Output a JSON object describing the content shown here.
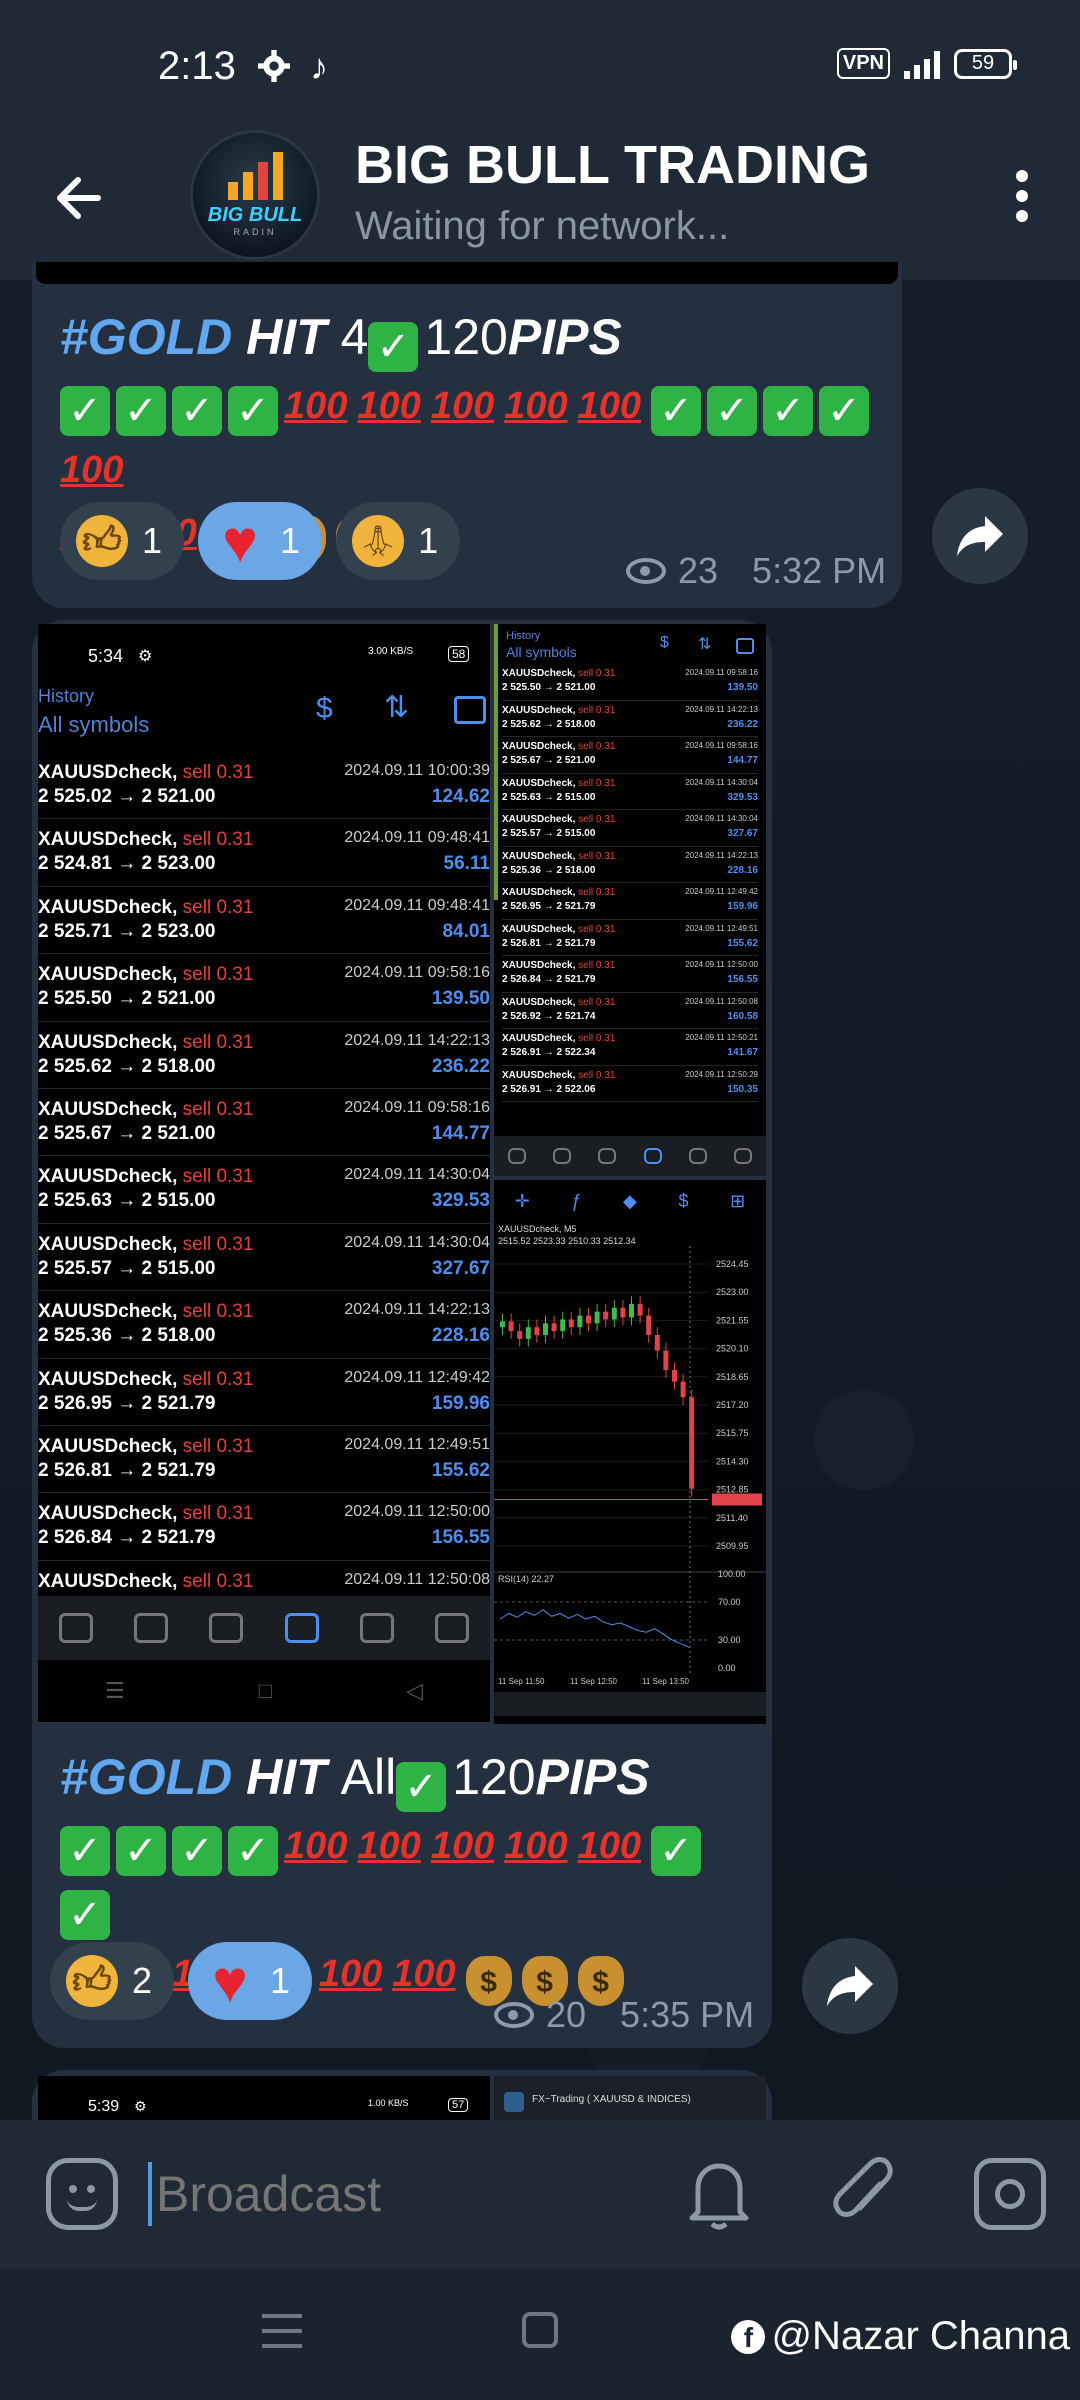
{
  "status": {
    "time": "2:13",
    "vpn": "VPN",
    "battery": "59"
  },
  "header": {
    "title": "BIG BULL TRADING",
    "subtitle": "Waiting for network...",
    "avatar_text": "BIG BULL",
    "avatar_sub": "RADIN"
  },
  "message1": {
    "line1": {
      "hashtag": "#GOLD",
      "hit": "HIT",
      "num": "4",
      "pips_val": "120",
      "pips": "PIPS"
    },
    "reactions": [
      {
        "emoji": "thumbs-up",
        "count": "1"
      },
      {
        "emoji": "heart",
        "count": "1"
      },
      {
        "emoji": "pray",
        "count": "1"
      }
    ],
    "views": "23",
    "time": "5:32 PM"
  },
  "phone_shot": {
    "time": "5:34",
    "speed": "3.00 KB/S",
    "battery": "58",
    "history": "History",
    "all_symbols": "All symbols",
    "rows": [
      {
        "sym": "XAUUSDcheck,",
        "side": "sell 0.31",
        "px": "2 525.02 → 2 521.00",
        "dt": "2024.09.11 10:00:39",
        "pl": "124.62"
      },
      {
        "sym": "XAUUSDcheck,",
        "side": "sell 0.31",
        "px": "2 524.81 → 2 523.00",
        "dt": "2024.09.11 09:48:41",
        "pl": "56.11"
      },
      {
        "sym": "XAUUSDcheck,",
        "side": "sell 0.31",
        "px": "2 525.71 → 2 523.00",
        "dt": "2024.09.11 09:48:41",
        "pl": "84.01"
      },
      {
        "sym": "XAUUSDcheck,",
        "side": "sell 0.31",
        "px": "2 525.50 → 2 521.00",
        "dt": "2024.09.11 09:58:16",
        "pl": "139.50"
      },
      {
        "sym": "XAUUSDcheck,",
        "side": "sell 0.31",
        "px": "2 525.62 → 2 518.00",
        "dt": "2024.09.11 14:22:13",
        "pl": "236.22"
      },
      {
        "sym": "XAUUSDcheck,",
        "side": "sell 0.31",
        "px": "2 525.67 → 2 521.00",
        "dt": "2024.09.11 09:58:16",
        "pl": "144.77"
      },
      {
        "sym": "XAUUSDcheck,",
        "side": "sell 0.31",
        "px": "2 525.63 → 2 515.00",
        "dt": "2024.09.11 14:30:04",
        "pl": "329.53"
      },
      {
        "sym": "XAUUSDcheck,",
        "side": "sell 0.31",
        "px": "2 525.57 → 2 515.00",
        "dt": "2024.09.11 14:30:04",
        "pl": "327.67"
      },
      {
        "sym": "XAUUSDcheck,",
        "side": "sell 0.31",
        "px": "2 525.36 → 2 518.00",
        "dt": "2024.09.11 14:22:13",
        "pl": "228.16"
      },
      {
        "sym": "XAUUSDcheck,",
        "side": "sell 0.31",
        "px": "2 526.95 → 2 521.79",
        "dt": "2024.09.11 12:49:42",
        "pl": "159.96"
      },
      {
        "sym": "XAUUSDcheck,",
        "side": "sell 0.31",
        "px": "2 526.81 → 2 521.79",
        "dt": "2024.09.11 12:49:51",
        "pl": "155.62"
      },
      {
        "sym": "XAUUSDcheck,",
        "side": "sell 0.31",
        "px": "2 526.84 → 2 521.79",
        "dt": "2024.09.11 12:50:00",
        "pl": "156.55"
      },
      {
        "sym": "XAUUSDcheck,",
        "side": "sell 0.31",
        "px": "",
        "dt": "2024.09.11 12:50:08",
        "pl": ""
      }
    ]
  },
  "small_shot": {
    "history": "History",
    "all_symbols": "All symbols",
    "rows": [
      {
        "sym": "XAUUSDcheck,",
        "side": "sell 0.31",
        "px": "2 525.50 → 2 521.00",
        "dt": "2024.09.11 09:58:16",
        "pl": "139.50"
      },
      {
        "sym": "XAUUSDcheck,",
        "side": "sell 0.31",
        "px": "2 525.62 → 2 518.00",
        "dt": "2024.09.11 14:22:13",
        "pl": "236.22"
      },
      {
        "sym": "XAUUSDcheck,",
        "side": "sell 0.31",
        "px": "2 525.67 → 2 521.00",
        "dt": "2024.09.11 09:58:16",
        "pl": "144.77"
      },
      {
        "sym": "XAUUSDcheck,",
        "side": "sell 0.31",
        "px": "2 525.63 → 2 515.00",
        "dt": "2024.09.11 14:30:04",
        "pl": "329.53"
      },
      {
        "sym": "XAUUSDcheck,",
        "side": "sell 0.31",
        "px": "2 525.57 → 2 515.00",
        "dt": "2024.09.11 14:30:04",
        "pl": "327.67"
      },
      {
        "sym": "XAUUSDcheck,",
        "side": "sell 0.31",
        "px": "2 525.36 → 2 518.00",
        "dt": "2024.09.11 14:22:13",
        "pl": "228.16"
      },
      {
        "sym": "XAUUSDcheck,",
        "side": "sell 0.31",
        "px": "2 526.95 → 2 521.79",
        "dt": "2024.09.11 12:49:42",
        "pl": "159.96"
      },
      {
        "sym": "XAUUSDcheck,",
        "side": "sell 0.31",
        "px": "2 526.81 → 2 521.79",
        "dt": "2024.09.11 12:49:51",
        "pl": "155.62"
      },
      {
        "sym": "XAUUSDcheck,",
        "side": "sell 0.31",
        "px": "2 526.84 → 2 521.79",
        "dt": "2024.09.11 12:50:00",
        "pl": "156.55"
      },
      {
        "sym": "XAUUSDcheck,",
        "side": "sell 0.31",
        "px": "2 526.92 → 2 521.74",
        "dt": "2024.09.11 12:50:08",
        "pl": "160.58"
      },
      {
        "sym": "XAUUSDcheck,",
        "side": "sell 0.31",
        "px": "2 526.91 → 2 522.34",
        "dt": "2024.09.11 12:50:21",
        "pl": "141.67"
      },
      {
        "sym": "XAUUSDcheck,",
        "side": "sell 0.31",
        "px": "2 526.91 → 2 522.06",
        "dt": "2024.09.11 12:50:29",
        "pl": "150.35"
      }
    ]
  },
  "chart_shot": {
    "symbol": "XAUUSDcheck, M5",
    "ohlc": "2515.52 2523.33 2510.33 2512.34",
    "price_labels": [
      "2524.45",
      "2523.00",
      "2521.55",
      "2520.10",
      "2518.65",
      "2517.20",
      "2515.75",
      "2514.30",
      "2512.85",
      "2511.40",
      "2509.95"
    ],
    "rsi_label": "RSI(14) 22.27",
    "rsi_levels": [
      "100.00",
      "70.00",
      "30.00",
      "0.00"
    ],
    "time_labels": [
      "11 Sep 11:50",
      "11 Sep 12:50",
      "11 Sep 13:50"
    ]
  },
  "message2": {
    "line1": {
      "hashtag": "#GOLD",
      "hit": "HIT",
      "all": "All",
      "pips_val": "120",
      "pips": "PIPS"
    },
    "reactions": [
      {
        "emoji": "thumbs-up",
        "count": "2"
      },
      {
        "emoji": "heart",
        "count": "1"
      }
    ],
    "views": "20",
    "time": "5:35 PM"
  },
  "next_preview": {
    "time": "5:39",
    "speed": "1.00 KB/S",
    "battery": "57",
    "title": "FX~Trading ( XAUUSD & INDICES)"
  },
  "input": {
    "placeholder": "Broadcast"
  },
  "watermark": {
    "text": "@Nazar Channa"
  },
  "colors": {
    "accent": "#62a8f0",
    "bubble": "#243040",
    "header": "#1f2a36",
    "reaction_active": "#6ba6e6"
  }
}
